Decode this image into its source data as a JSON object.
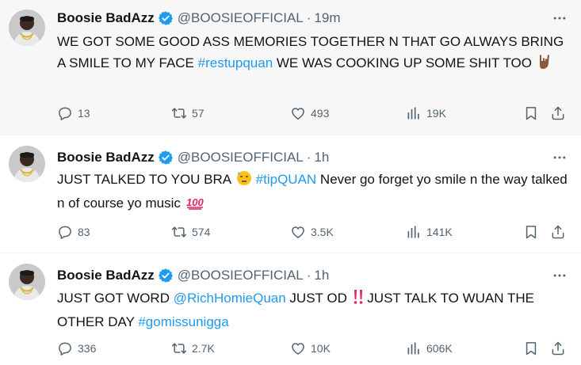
{
  "colors": {
    "link": "#1d9bf0",
    "muted": "#536471",
    "verified": "#1d9bf0",
    "highlight_bg": "#f7f7f7"
  },
  "tweets": [
    {
      "name": "Boosie BadAzz",
      "handle": "@BOOSIEOFFICIAL",
      "separator": "·",
      "time": "19m",
      "text_parts": {
        "a": "WE GOT SOME GOOD ASS MEMORIES TOGETHER N THAT GO ALWAYS BRING A SMILE TO MY FACE ",
        "tag1": "#restupquan",
        "b": " WE WAS COOKING UP SOME SHIT TOO "
      },
      "emoji": "sign-of-the-horns-icon",
      "replies": "13",
      "reposts": "57",
      "likes": "493",
      "views": "19K"
    },
    {
      "name": "Boosie BadAzz",
      "handle": "@BOOSIEOFFICIAL",
      "separator": "·",
      "time": "1h",
      "text_parts": {
        "a": "JUST TALKED TO YOU BRA ",
        "tag1": "#tipQUAN",
        "b": "  Never go forget yo smile n the way talked n of course yo music "
      },
      "emoji": "hundred-points-icon",
      "replies": "83",
      "reposts": "574",
      "likes": "3.5K",
      "views": "141K"
    },
    {
      "name": "Boosie BadAzz",
      "handle": "@BOOSIEOFFICIAL",
      "separator": "·",
      "time": "1h",
      "text_parts": {
        "a": "JUST GOT WORD ",
        "tag1": "@RichHomieQuan",
        "b": " JUST OD ",
        "c": " JUST TALK TO WUAN THE OTHER DAY ",
        "tag2": "#gomissunigga"
      },
      "emoji": "double-exclamation-icon",
      "replies": "336",
      "reposts": "2.7K",
      "likes": "10K",
      "views": "606K"
    }
  ]
}
